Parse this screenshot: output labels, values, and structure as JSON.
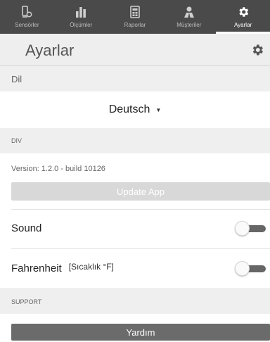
{
  "tabs": [
    {
      "label": "Sensörler",
      "icon": "sensor-device-icon",
      "active": false
    },
    {
      "label": "Ölçümler",
      "icon": "bar-chart-icon",
      "active": false
    },
    {
      "label": "Raporlar",
      "icon": "report-icon",
      "active": false
    },
    {
      "label": "Müşteriler",
      "icon": "customers-icon",
      "active": false
    },
    {
      "label": "Ayarlar",
      "icon": "gear-icon",
      "active": true
    }
  ],
  "header": {
    "title": "Ayarlar",
    "icon": "gear-icon"
  },
  "language": {
    "section_label": "Dil",
    "selected": "Deutsch"
  },
  "div_section": {
    "label": "DIV",
    "version_text": "Version: 1.2.0 - build 10126",
    "update_label": "Update App"
  },
  "sound": {
    "label": "Sound",
    "enabled": false
  },
  "fahrenheit": {
    "label": "Fahrenheit",
    "sublabel": "[Sıcaklık °F]",
    "enabled": false
  },
  "support": {
    "label": "SUPPORT",
    "help_label": "Yardım"
  },
  "colors": {
    "tabbar": "#4a4a4a",
    "header": "#eeeeee",
    "help_button": "#6b6b6b",
    "update_button": "#d8d8d8"
  }
}
